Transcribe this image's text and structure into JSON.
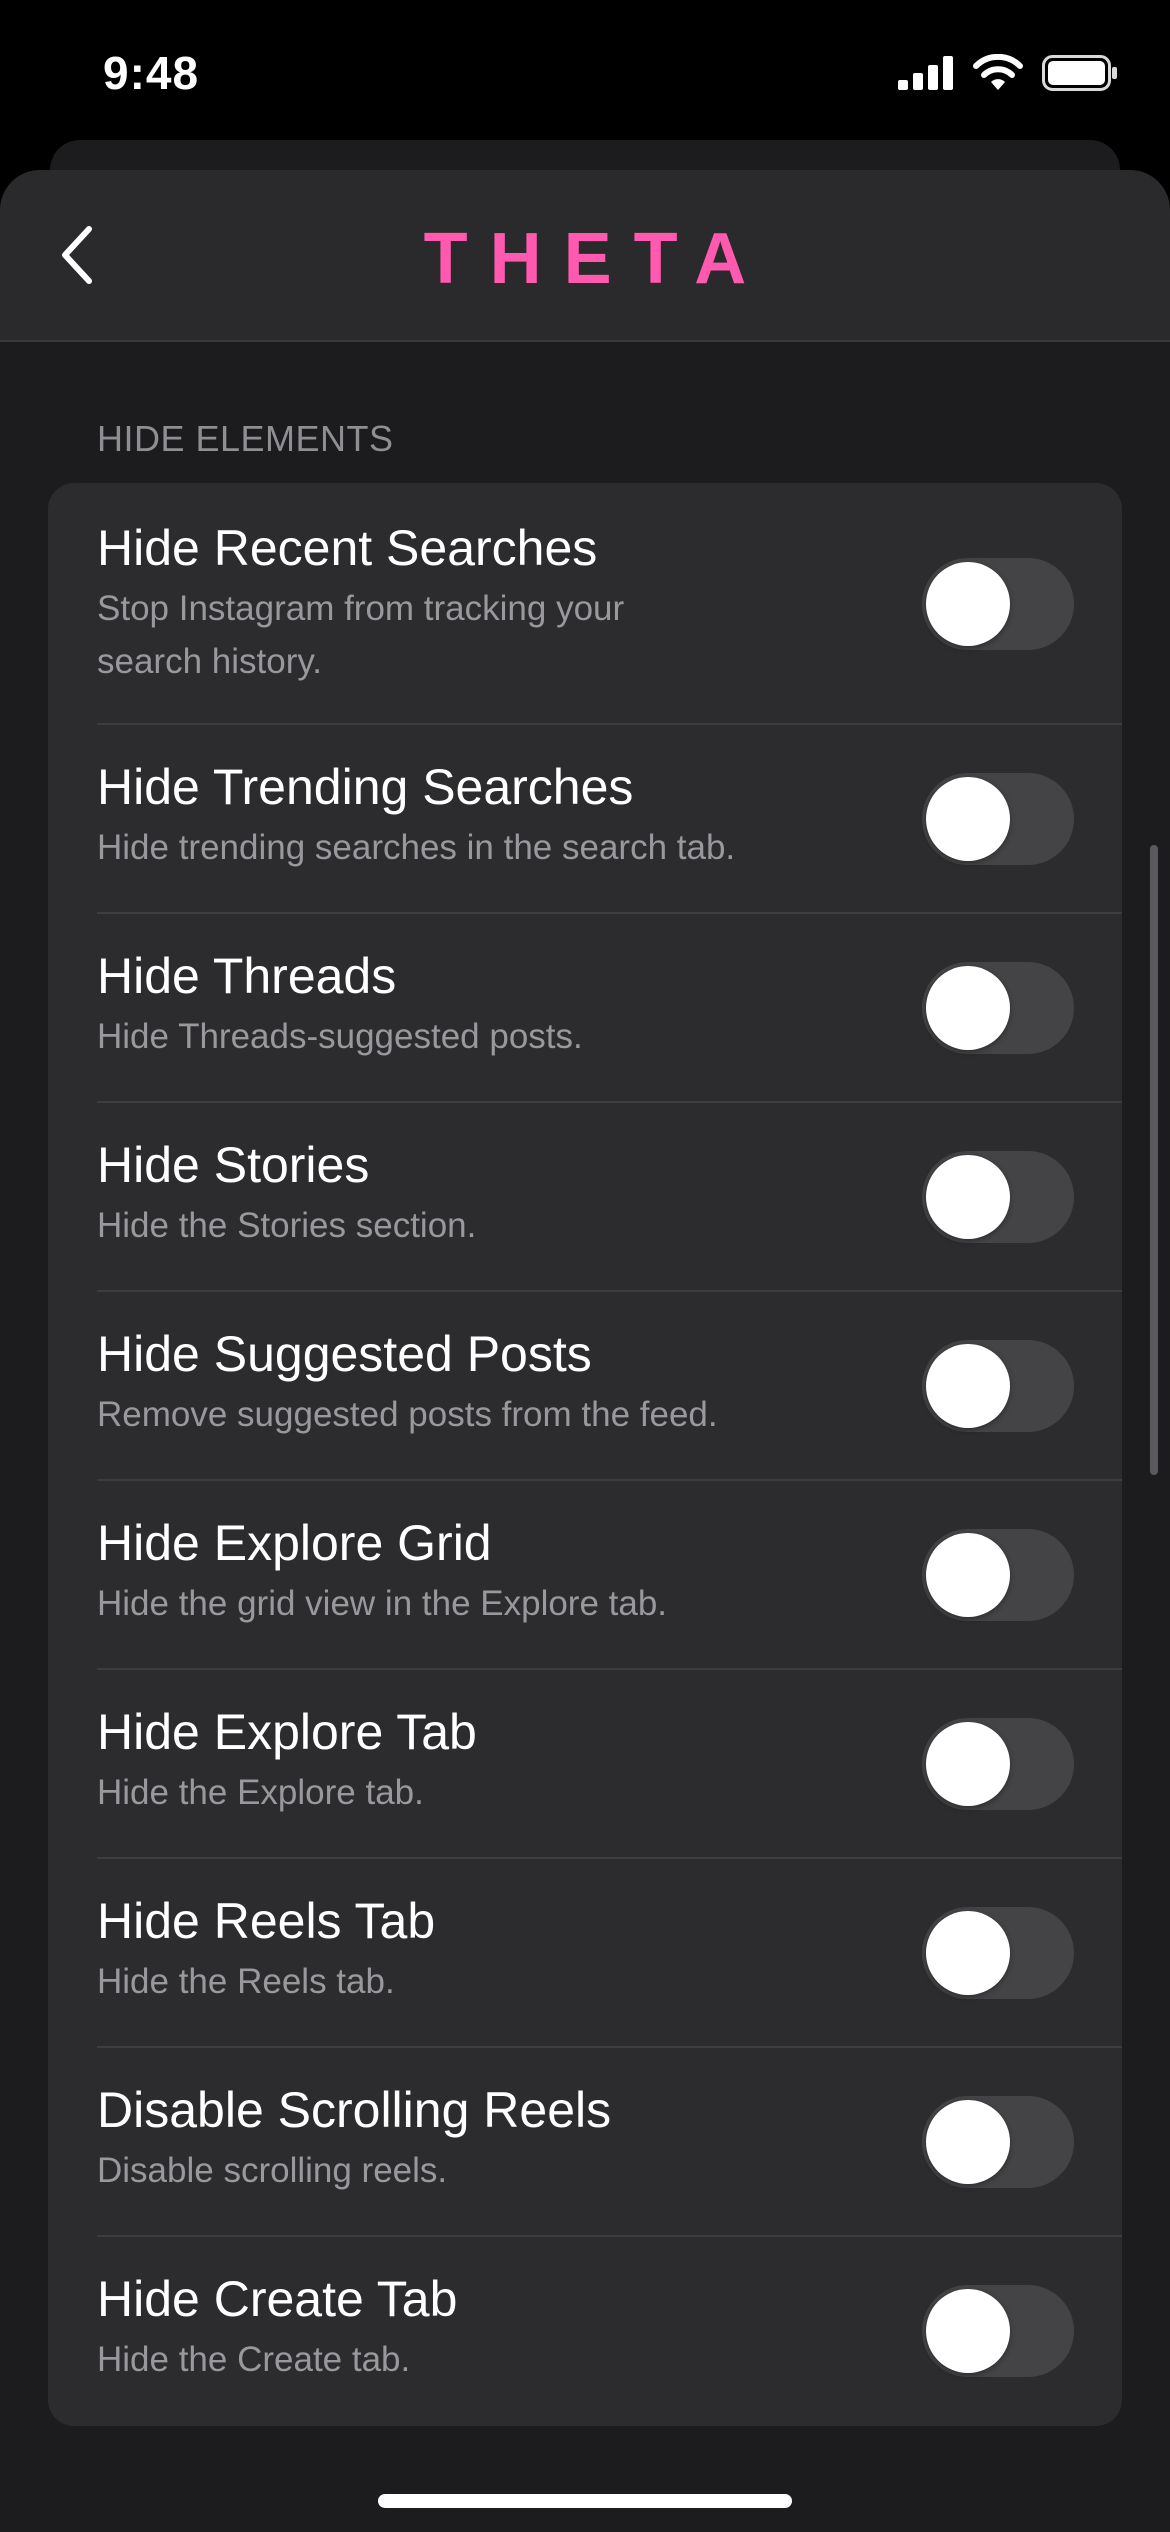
{
  "status_bar": {
    "time": "9:48"
  },
  "nav": {
    "title": "THETA",
    "accent": "#ff5ab0",
    "back_icon": "chevron-left-icon"
  },
  "section": {
    "header": "HIDE ELEMENTS"
  },
  "settings": [
    {
      "title": "Hide Recent Searches",
      "subtitle": "Stop Instagram from tracking your search history.",
      "enabled": false
    },
    {
      "title": "Hide Trending Searches",
      "subtitle": "Hide trending searches in the search tab.",
      "enabled": false
    },
    {
      "title": "Hide Threads",
      "subtitle": "Hide Threads-suggested posts.",
      "enabled": false
    },
    {
      "title": "Hide Stories",
      "subtitle": "Hide the Stories section.",
      "enabled": false
    },
    {
      "title": "Hide Suggested Posts",
      "subtitle": "Remove suggested posts from the feed.",
      "enabled": false
    },
    {
      "title": "Hide Explore Grid",
      "subtitle": "Hide the grid view in the Explore tab.",
      "enabled": false
    },
    {
      "title": "Hide Explore Tab",
      "subtitle": "Hide the Explore tab.",
      "enabled": false
    },
    {
      "title": "Hide Reels Tab",
      "subtitle": "Hide the Reels tab.",
      "enabled": false
    },
    {
      "title": "Disable Scrolling Reels",
      "subtitle": "Disable scrolling reels.",
      "enabled": false
    },
    {
      "title": "Hide Create Tab",
      "subtitle": "Hide the Create tab.",
      "enabled": false
    }
  ]
}
